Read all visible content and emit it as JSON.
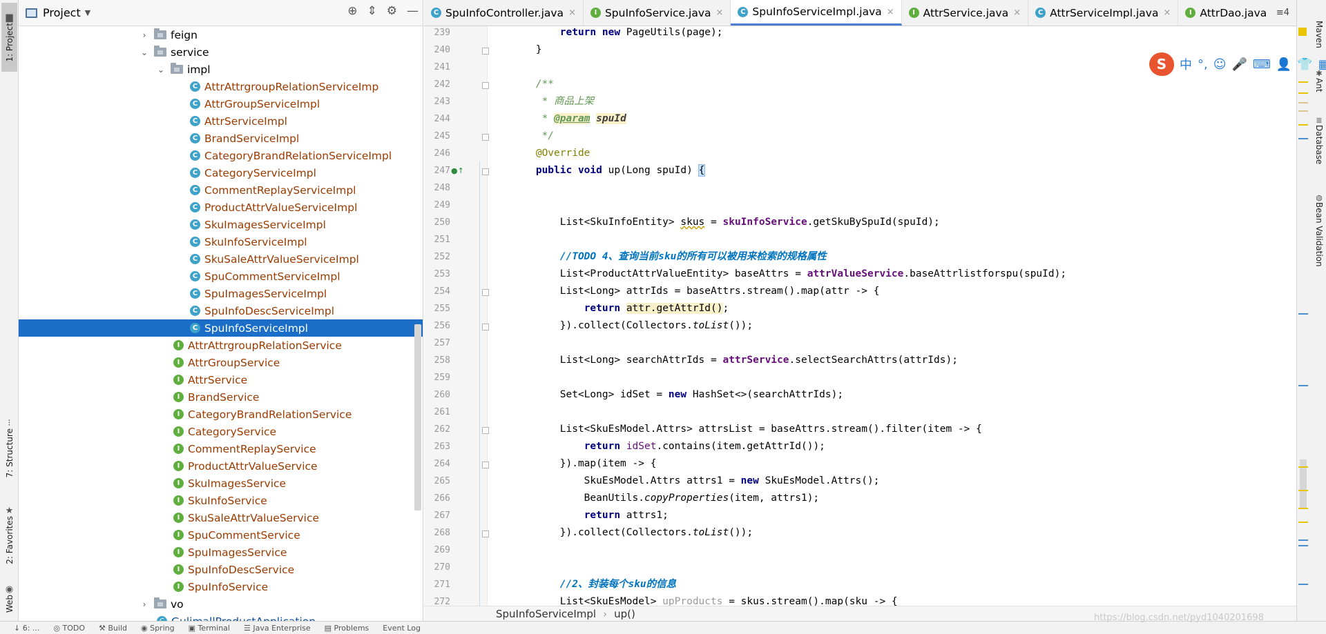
{
  "left_strip": {
    "tabs": [
      {
        "label": "1: Project",
        "icon": "folder-icon"
      },
      {
        "label": "7: Structure",
        "icon": "structure-icon"
      },
      {
        "label": "2: Favorites",
        "icon": "star-icon"
      },
      {
        "label": "Web",
        "icon": "web-icon"
      }
    ]
  },
  "project_panel": {
    "title": "Project",
    "tools": [
      "locate-icon",
      "collapse-icon",
      "gear-icon",
      "minimize-icon"
    ]
  },
  "tree": [
    {
      "label": "feign",
      "kind": "folder",
      "indent": 1,
      "arrow": "›"
    },
    {
      "label": "service",
      "kind": "folder",
      "indent": 1,
      "arrow": "⌄"
    },
    {
      "label": "impl",
      "kind": "folder",
      "indent": 2,
      "arrow": "⌄"
    },
    {
      "label": "AttrAttrgroupRelationServiceImp",
      "kind": "class",
      "indent": 3
    },
    {
      "label": "AttrGroupServiceImpl",
      "kind": "class",
      "indent": 3
    },
    {
      "label": "AttrServiceImpl",
      "kind": "class",
      "indent": 3
    },
    {
      "label": "BrandServiceImpl",
      "kind": "class",
      "indent": 3
    },
    {
      "label": "CategoryBrandRelationServiceImpl",
      "kind": "class",
      "indent": 3
    },
    {
      "label": "CategoryServiceImpl",
      "kind": "class",
      "indent": 3
    },
    {
      "label": "CommentReplayServiceImpl",
      "kind": "class",
      "indent": 3
    },
    {
      "label": "ProductAttrValueServiceImpl",
      "kind": "class",
      "indent": 3
    },
    {
      "label": "SkuImagesServiceImpl",
      "kind": "class",
      "indent": 3
    },
    {
      "label": "SkuInfoServiceImpl",
      "kind": "class",
      "indent": 3
    },
    {
      "label": "SkuSaleAttrValueServiceImpl",
      "kind": "class",
      "indent": 3
    },
    {
      "label": "SpuCommentServiceImpl",
      "kind": "class",
      "indent": 3
    },
    {
      "label": "SpuImagesServiceImpl",
      "kind": "class",
      "indent": 3
    },
    {
      "label": "SpuInfoDescServiceImpl",
      "kind": "class",
      "indent": 3
    },
    {
      "label": "SpuInfoServiceImpl",
      "kind": "class",
      "indent": 3,
      "selected": true
    },
    {
      "label": "AttrAttrgroupRelationService",
      "kind": "interface",
      "indent": 2
    },
    {
      "label": "AttrGroupService",
      "kind": "interface",
      "indent": 2
    },
    {
      "label": "AttrService",
      "kind": "interface",
      "indent": 2
    },
    {
      "label": "BrandService",
      "kind": "interface",
      "indent": 2
    },
    {
      "label": "CategoryBrandRelationService",
      "kind": "interface",
      "indent": 2
    },
    {
      "label": "CategoryService",
      "kind": "interface",
      "indent": 2
    },
    {
      "label": "CommentReplayService",
      "kind": "interface",
      "indent": 2
    },
    {
      "label": "ProductAttrValueService",
      "kind": "interface",
      "indent": 2
    },
    {
      "label": "SkuImagesService",
      "kind": "interface",
      "indent": 2
    },
    {
      "label": "SkuInfoService",
      "kind": "interface",
      "indent": 2
    },
    {
      "label": "SkuSaleAttrValueService",
      "kind": "interface",
      "indent": 2
    },
    {
      "label": "SpuCommentService",
      "kind": "interface",
      "indent": 2
    },
    {
      "label": "SpuImagesService",
      "kind": "interface",
      "indent": 2
    },
    {
      "label": "SpuInfoDescService",
      "kind": "interface",
      "indent": 2
    },
    {
      "label": "SpuInfoService",
      "kind": "interface",
      "indent": 2
    },
    {
      "label": "vo",
      "kind": "folder",
      "indent": 1,
      "arrow": "›"
    },
    {
      "label": "GulimallProductApplication",
      "kind": "app",
      "indent": 1
    }
  ],
  "tabs": [
    {
      "label": "SpuInfoController.java",
      "kind": "c"
    },
    {
      "label": "SpuInfoService.java",
      "kind": "i"
    },
    {
      "label": "SpuInfoServiceImpl.java",
      "kind": "c",
      "active": true
    },
    {
      "label": "AttrService.java",
      "kind": "i"
    },
    {
      "label": "AttrServiceImpl.java",
      "kind": "c"
    },
    {
      "label": "AttrDao.java",
      "kind": "i"
    }
  ],
  "tab_overflow": "≡4",
  "code_lines": [
    {
      "n": "239",
      "html": "        <span class=\"kw\">return new</span> PageUtils(page);"
    },
    {
      "n": "240",
      "html": "    }",
      "fold": true
    },
    {
      "n": "241",
      "html": ""
    },
    {
      "n": "242",
      "html": "    <span class=\"doc\">/**</span>",
      "fold": true
    },
    {
      "n": "243",
      "html": "    <span class=\"doc\"> * 商品上架</span>"
    },
    {
      "n": "244",
      "html": "    <span class=\"doc\"> * </span><span class=\"doctag\">@param</span> <span class=\"docparam\">spuId</span>"
    },
    {
      "n": "245",
      "html": "    <span class=\"doc\"> */</span>",
      "fold": true
    },
    {
      "n": "246",
      "html": "    <span class=\"ann\">@Override</span>"
    },
    {
      "n": "247",
      "html": "    <span class=\"kw\">public void</span> up(Long spuId) <span class=\"brace-hl\">{</span>",
      "fold": true,
      "mark": "●↑"
    },
    {
      "n": "248",
      "html": ""
    },
    {
      "n": "249",
      "html": ""
    },
    {
      "n": "250",
      "html": "        List&lt;SkuInfoEntity&gt; <span class=\"warnul\">skus</span> = <span class=\"fld\">skuInfoService</span>.getSkuBySpuId(spuId);"
    },
    {
      "n": "251",
      "html": ""
    },
    {
      "n": "252",
      "html": "        <span class=\"todo\">//TODO 4、查询当前sku的所有可以被用来检索的规格属性</span>"
    },
    {
      "n": "253",
      "html": "        List&lt;ProductAttrValueEntity&gt; baseAttrs = <span class=\"fld\">attrValueService</span>.baseAttrlistforspu(spuId);"
    },
    {
      "n": "254",
      "html": "        List&lt;Long&gt; attrIds = baseAttrs.stream().map(attr -&gt; {",
      "fold": true
    },
    {
      "n": "255",
      "html": "            <span class=\"kw\">return</span> <span class=\"hl\">attr.getAttrId()</span>;"
    },
    {
      "n": "256",
      "html": "        }).collect(Collectors.<span class=\"st\">toList</span>());",
      "fold": true
    },
    {
      "n": "257",
      "html": ""
    },
    {
      "n": "258",
      "html": "        List&lt;Long&gt; searchAttrIds = <span class=\"fld\">attrService</span>.selectSearchAttrs(attrIds);"
    },
    {
      "n": "259",
      "html": ""
    },
    {
      "n": "260",
      "html": "        Set&lt;Long&gt; idSet = <span class=\"kw\">new</span> HashSet&lt;&gt;(searchAttrIds);"
    },
    {
      "n": "261",
      "html": ""
    },
    {
      "n": "262",
      "html": "        List&lt;SkuEsModel.Attrs&gt; attrsList = baseAttrs.stream().filter(item -&gt; {",
      "fold": true
    },
    {
      "n": "263",
      "html": "            <span class=\"kw\">return</span> <span class=\"fldp\">idSet</span>.contains(item.getAttrId());"
    },
    {
      "n": "264",
      "html": "        }).map(item -&gt; {",
      "fold": true
    },
    {
      "n": "265",
      "html": "            SkuEsModel.Attrs attrs1 = <span class=\"kw\">new</span> SkuEsModel.Attrs();"
    },
    {
      "n": "266",
      "html": "            BeanUtils.<span class=\"st\">copyProperties</span>(item, attrs1);"
    },
    {
      "n": "267",
      "html": "            <span class=\"kw\">return</span> attrs1;"
    },
    {
      "n": "268",
      "html": "        }).collect(Collectors.<span class=\"st\">toList</span>());",
      "fold": true
    },
    {
      "n": "269",
      "html": ""
    },
    {
      "n": "270",
      "html": ""
    },
    {
      "n": "271",
      "html": "        <span class=\"todo\">//2、封装每个sku的信息</span>"
    },
    {
      "n": "272",
      "html": "        List&lt;SkuEsModel&gt; <span class=\"gray\">upProducts</span> = skus.stream().map(sku -&gt; {"
    }
  ],
  "breadcrumb": {
    "class": "SpuInfoServiceImpl",
    "sep": "›",
    "method": "up()"
  },
  "right_strip": {
    "tabs": [
      {
        "label": "Maven",
        "icon": "maven-icon"
      },
      {
        "label": "Ant",
        "icon": "ant-icon"
      },
      {
        "label": "Database",
        "icon": "database-icon"
      },
      {
        "label": "Bean Validation",
        "icon": "bean-icon"
      }
    ]
  },
  "ime_bar": {
    "logo": "S",
    "buttons": [
      "中",
      "°,",
      "☺",
      "🎤",
      "⌨",
      "👤",
      "👕",
      "▦"
    ]
  },
  "statusbar": {
    "items": [
      "↓ 6: ...",
      "◎ TODO",
      "⚒ Build",
      "◉ Spring",
      "▣ Terminal",
      "☰ Java Enterprise",
      "▤ Problems",
      "Event Log"
    ]
  },
  "watermark": "https://blog.csdn.net/pyd1040201698",
  "colors": {
    "accent": "#1a6ec7",
    "keyword": "#000080",
    "field": "#660e7a",
    "doc": "#629755",
    "todo": "#0073bf"
  }
}
